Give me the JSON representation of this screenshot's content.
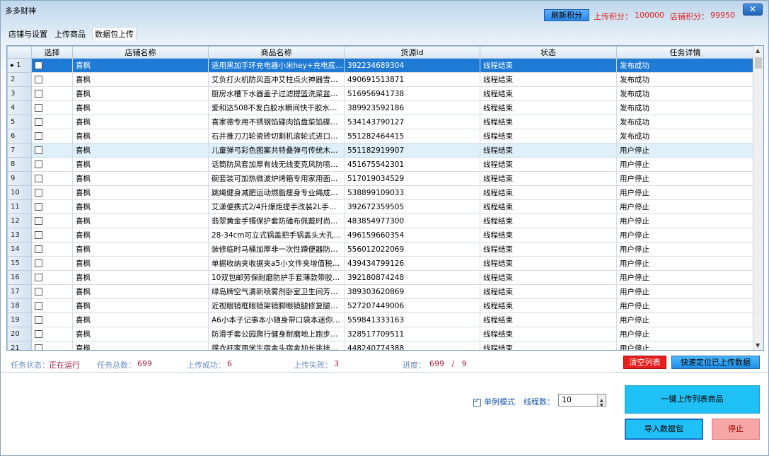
{
  "window": {
    "title": "多多财神",
    "close_glyph": "✕",
    "refresh_label": "刷新积分",
    "upload_points_label": "上传积分：",
    "upload_points_value": "100000",
    "store_points_label": "店铺积分：",
    "store_points_value": "99950"
  },
  "menu": [
    "店铺与设置",
    "上传商品",
    "数据包上传"
  ],
  "grid": {
    "headers": [
      "选择",
      "店铺名称",
      "商品名称",
      "货源Id",
      "状态",
      "任务详情"
    ],
    "rows": [
      {
        "n": "1",
        "store": "喜枫",
        "product": "适用黑加手环充电器小米hey+充电底…",
        "source_id": "392234689304",
        "status": "线程结束",
        "detail": "发布成功"
      },
      {
        "n": "2",
        "store": "喜枫",
        "product": "艾负打火机防风直冲艾柱点火神器雪…",
        "source_id": "490691513871",
        "status": "线程结束",
        "detail": "发布成功"
      },
      {
        "n": "3",
        "store": "喜枫",
        "product": "厨房水槽下水器盖子过滤提篮洗菜盆…",
        "source_id": "516956941738",
        "status": "线程结束",
        "detail": "发布成功"
      },
      {
        "n": "4",
        "store": "喜枫",
        "product": "爱和达508不发白胶水瞬间快干胶水…",
        "source_id": "389923592186",
        "status": "线程结束",
        "detail": "发布成功"
      },
      {
        "n": "5",
        "store": "喜枫",
        "product": "喜家德专用不锈钢馅碟肉馅盘菜馅碟…",
        "source_id": "534143790127",
        "status": "线程结束",
        "detail": "发布成功"
      },
      {
        "n": "6",
        "store": "喜枫",
        "product": "石井推刀刀轮瓷砖切割机滚轮式进口…",
        "source_id": "551282464415",
        "status": "线程结束",
        "detail": "发布成功"
      },
      {
        "n": "7",
        "store": "喜枫",
        "product": "儿童弹弓彩色图案共特叠弹弓传统木…",
        "source_id": "551182919907",
        "status": "线程结束",
        "detail": "用户停止"
      },
      {
        "n": "8",
        "store": "喜枫",
        "product": "话筒防风套加厚有线无线麦克风防喷…",
        "source_id": "451675542301",
        "status": "线程结束",
        "detail": "用户停止"
      },
      {
        "n": "9",
        "store": "喜枫",
        "product": "碗套装可加热微波炉烤箱专用家用面…",
        "source_id": "517019034529",
        "status": "线程结束",
        "detail": "用户停止"
      },
      {
        "n": "10",
        "store": "喜枫",
        "product": "跳绳健身减肥运动燃脂瘦身专业绳成…",
        "source_id": "538899109033",
        "status": "线程结束",
        "detail": "用户停止"
      },
      {
        "n": "11",
        "store": "喜枫",
        "product": "艾漾便携式2/4升爆炬提手改装2L手…",
        "source_id": "392672359505",
        "status": "线程结束",
        "detail": "用户停止"
      },
      {
        "n": "12",
        "store": "喜枫",
        "product": "翡翠黄金手镯保护套防磕布佩戴时尚…",
        "source_id": "483854977300",
        "status": "线程结束",
        "detail": "用户停止"
      },
      {
        "n": "13",
        "store": "喜枫",
        "product": "28-34cm可立式锅盖把手锅盖头大孔…",
        "source_id": "496159660354",
        "status": "线程结束",
        "detail": "用户停止"
      },
      {
        "n": "14",
        "store": "喜枫",
        "product": "装修临时马桶加厚非一次性蹲便器防…",
        "source_id": "556012022069",
        "status": "线程结束",
        "detail": "用户停止"
      },
      {
        "n": "15",
        "store": "喜枫",
        "product": "单据收纳夹收据夹a5小文件夹增值税…",
        "source_id": "439434799126",
        "status": "线程结束",
        "detail": "用户停止"
      },
      {
        "n": "16",
        "store": "喜枫",
        "product": "10双包邮劳保耐磨防护手套薄款带胶…",
        "source_id": "392180874248",
        "status": "线程结束",
        "detail": "用户停止"
      },
      {
        "n": "17",
        "store": "喜枫",
        "product": "绿岛牌空气清新喷雾剂卧室卫生间芳…",
        "source_id": "389303620869",
        "status": "线程结束",
        "detail": "用户停止"
      },
      {
        "n": "18",
        "store": "喜枫",
        "product": "近视眼镜框眼镜架镜脚眼镜腿修复腿…",
        "source_id": "527207449006",
        "status": "线程结束",
        "detail": "用户停止"
      },
      {
        "n": "19",
        "store": "喜枫",
        "product": "A6小本子记事本小随身带口袋本迷你…",
        "source_id": "559841333163",
        "status": "线程结束",
        "detail": "用户停止"
      },
      {
        "n": "20",
        "store": "喜枫",
        "product": "防滑手套公园爬行健身耐磨地上跑步…",
        "source_id": "328517709511",
        "status": "线程结束",
        "detail": "用户停止"
      },
      {
        "n": "21",
        "store": "喜枫",
        "product": "撑衣杆家用学生宿舍头宿舍加长挑挂…",
        "source_id": "448240774388",
        "status": "线程结束",
        "detail": "用户停止"
      }
    ]
  },
  "status": {
    "task_state_label": "任务状态：",
    "task_state_value": "正在运行",
    "task_total_label": "任务总数：",
    "task_total_value": "699",
    "upload_success_label": "上传成功：",
    "upload_success_value": "6",
    "upload_fail_label": "上传失败：",
    "upload_fail_value": "3",
    "progress_label": "进度：",
    "progress_value": "699   /   9",
    "clear_list_label": "清空列表",
    "locate_label": "快速定位已上传数据"
  },
  "controls": {
    "single_mode_label": "单例模式",
    "thread_count_label": "线程数：",
    "thread_count_value": "10",
    "upload_all_label": "一键上传列表商品",
    "import_label": "导入数据包",
    "stop_label": "停止"
  },
  "colors": {
    "selected_row": "#1f7ad6",
    "points_red": "#e0241f",
    "clear_btn": "#e81f1f",
    "action_btn": "#1ec0f5",
    "stop_btn": "#f6a6a6"
  }
}
